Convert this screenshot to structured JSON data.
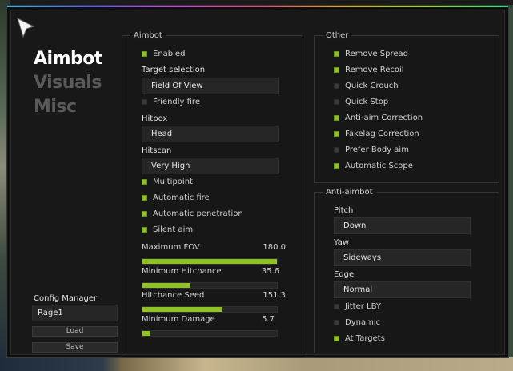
{
  "tabs": [
    {
      "label": "Aimbot",
      "active": true
    },
    {
      "label": "Visuals",
      "active": false
    },
    {
      "label": "Misc",
      "active": false
    }
  ],
  "aimbot": {
    "title": "Aimbot",
    "enabled": {
      "label": "Enabled",
      "checked": true
    },
    "target_selection": {
      "label": "Target selection",
      "value": "Field Of View"
    },
    "friendly_fire": {
      "label": "Friendly fire",
      "checked": false
    },
    "hitbox": {
      "label": "Hitbox",
      "value": "Head"
    },
    "hitscan": {
      "label": "Hitscan",
      "value": "Very High"
    },
    "checks": [
      {
        "label": "Multipoint",
        "checked": true
      },
      {
        "label": "Automatic fire",
        "checked": true
      },
      {
        "label": "Automatic penetration",
        "checked": true
      },
      {
        "label": "Silent aim",
        "checked": true
      }
    ],
    "sliders": [
      {
        "label": "Maximum FOV",
        "value": "180.0",
        "fraction": 1.0
      },
      {
        "label": "Minimum Hitchance",
        "value": "35.6",
        "fraction": 0.356
      },
      {
        "label": "Hitchance Seed",
        "value": "151.3",
        "fraction": 0.593
      },
      {
        "label": "Minimum Damage",
        "value": "5.7",
        "fraction": 0.057
      }
    ]
  },
  "other": {
    "title": "Other",
    "checks": [
      {
        "label": "Remove Spread",
        "checked": true
      },
      {
        "label": "Remove Recoil",
        "checked": true
      },
      {
        "label": "Quick Crouch",
        "checked": false
      },
      {
        "label": "Quick Stop",
        "checked": false
      },
      {
        "label": "Anti-aim Correction",
        "checked": true
      },
      {
        "label": "Fakelag Correction",
        "checked": true
      },
      {
        "label": "Prefer Body aim",
        "checked": false
      },
      {
        "label": "Automatic Scope",
        "checked": true
      }
    ]
  },
  "anti_aimbot": {
    "title": "Anti-aimbot",
    "pitch": {
      "label": "Pitch",
      "value": "Down"
    },
    "yaw": {
      "label": "Yaw",
      "value": "Sideways"
    },
    "edge": {
      "label": "Edge",
      "value": "Normal"
    },
    "checks": [
      {
        "label": "Jitter LBY",
        "checked": false
      },
      {
        "label": "Dynamic",
        "checked": false
      },
      {
        "label": "At Targets",
        "checked": true
      }
    ]
  },
  "config": {
    "label": "Config Manager",
    "value": "Rage1",
    "load_label": "Load",
    "save_label": "Save"
  },
  "colors": {
    "accent": "#8fc227",
    "unchecked": "#3a3a3a",
    "panel": "#181818"
  },
  "icons": {
    "cursor": "cursor-arrow-icon"
  }
}
